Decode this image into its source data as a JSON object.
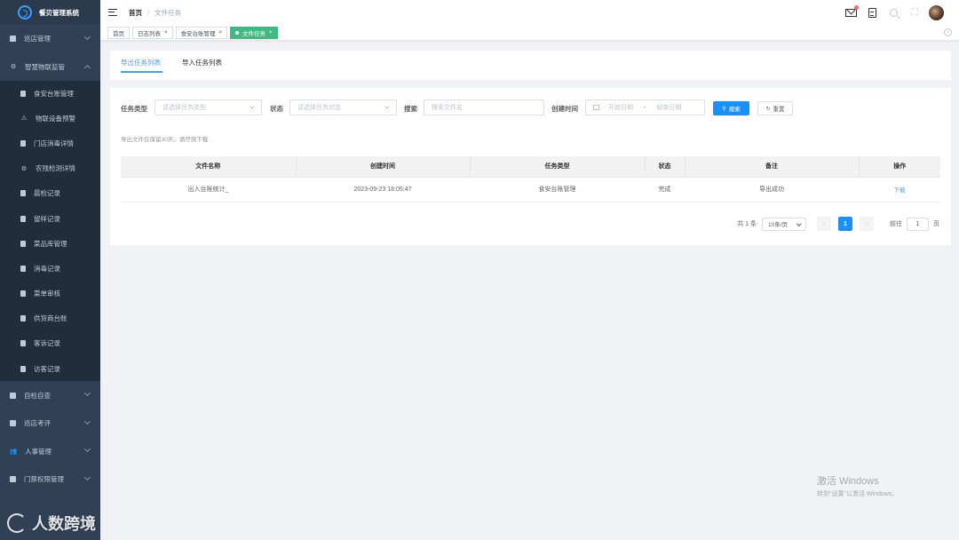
{
  "app": {
    "title": "餐贝管理系统"
  },
  "sidebar": {
    "items": [
      {
        "label": "巡店管理",
        "expanded": false
      },
      {
        "label": "智慧物联监管",
        "expanded": true,
        "children": [
          {
            "label": "食安台账管理"
          },
          {
            "label": "物联设备预警"
          },
          {
            "label": "门店消毒详情"
          },
          {
            "label": "农残检测详情"
          },
          {
            "label": "晨检记录"
          },
          {
            "label": "留样记录"
          },
          {
            "label": "菜品库管理"
          },
          {
            "label": "消毒记录"
          },
          {
            "label": "菜单审核"
          },
          {
            "label": "供货商台账"
          },
          {
            "label": "客诉记录"
          },
          {
            "label": "访客记录"
          }
        ]
      },
      {
        "label": "自检自查",
        "expanded": false
      },
      {
        "label": "巡店考评",
        "expanded": false
      },
      {
        "label": "人事管理",
        "expanded": false
      },
      {
        "label": "门禁权限管理",
        "expanded": false
      }
    ]
  },
  "header": {
    "breadcrumb": {
      "home": "首页",
      "separator": "/",
      "current": "文件任务"
    }
  },
  "tagsbar": {
    "tags": [
      {
        "label": "首页",
        "closable": false,
        "active": false
      },
      {
        "label": "日志列表",
        "closable": true,
        "active": false
      },
      {
        "label": "食安台账管理",
        "closable": true,
        "active": false
      },
      {
        "label": "文件任务",
        "closable": true,
        "active": true
      }
    ],
    "close_glyph": "×"
  },
  "tabs": [
    {
      "label": "导出任务列表",
      "active": true
    },
    {
      "label": "导入任务列表",
      "active": false
    }
  ],
  "filters": {
    "task_type": {
      "label": "任务类型",
      "placeholder": "请选择任务类型"
    },
    "status": {
      "label": "状态",
      "placeholder": "请选择任务状态"
    },
    "search": {
      "label": "搜索",
      "placeholder": "搜索文件名"
    },
    "created": {
      "label": "创建时间",
      "start_placeholder": "开始日期",
      "separator": "-",
      "end_placeholder": "结束日期"
    },
    "search_button": "搜索",
    "reset_button": "重置"
  },
  "tip": "导出文件仅保留30天，请尽快下载",
  "table": {
    "columns": [
      "文件名称",
      "创建时间",
      "任务类型",
      "状态",
      "备注",
      "操作"
    ],
    "rows": [
      {
        "file_name": "出入台账统计_",
        "created_at": "2023-09-23 18:05:47",
        "task_type": "食安台账管理",
        "status": "完成",
        "remark": "导出成功",
        "action": "下载"
      }
    ]
  },
  "pagination": {
    "total_text": "共 1 条",
    "page_size": "10条/页",
    "prev": "‹",
    "current_page": "1",
    "next": "›",
    "goto_label": "前往",
    "goto_value": "1",
    "page_suffix": "页"
  },
  "watermark": {
    "title": "激活 Windows",
    "subtitle": "转到\"设置\"以激活 Windows。"
  },
  "brand_watermark": "人数跨境",
  "colors": {
    "sidebar": "#304156",
    "primary": "#1890ff",
    "active_tag": "#42b983"
  }
}
